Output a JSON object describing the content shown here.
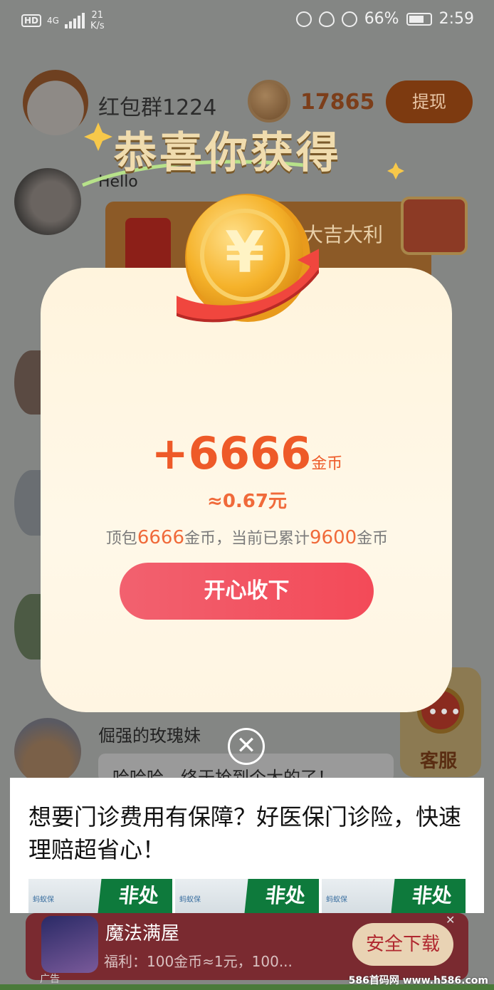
{
  "status_bar": {
    "network": "4G",
    "speed_value": "21",
    "speed_unit": "K/s",
    "battery": "66%",
    "time": "2:59"
  },
  "group": {
    "name": "红包群1224",
    "coin_count": "17865",
    "withdraw_label": "提现"
  },
  "chat": {
    "hello_text": "Hello",
    "redpacket_text": "大吉大利",
    "sender_name": "倔强的玫瑰妹",
    "message_text": "哈哈哈，终于抢到个大的了！"
  },
  "customer_service": {
    "label": "客服"
  },
  "popup": {
    "title": "恭喜你获得",
    "amount": "+6666",
    "amount_unit": "金币",
    "approx_value": "≈0.67元",
    "summary_prefix": "顶包",
    "summary_amount": "6666",
    "summary_middle": "金币，当前已累计",
    "summary_total": "9600",
    "summary_suffix": "金币",
    "accept_label": "开心收下",
    "close_symbol": "✕"
  },
  "ad": {
    "text": "想要门诊费用有保障？好医保门诊险，快速理赔超省心！",
    "image_brand": "蚂蚁保",
    "image_sign": "非处",
    "game_name": "魔法满屋",
    "game_bonus": "福利：100金币≈1元，100...",
    "download_label": "安全下载",
    "close_symbol": "✕",
    "ad_tag": "广告"
  },
  "watermark": "586首码网 www.h586.com",
  "colors": {
    "accent_orange": "#ee5a28",
    "button_red": "#f34a58",
    "popup_bg": "#fff4dd"
  }
}
